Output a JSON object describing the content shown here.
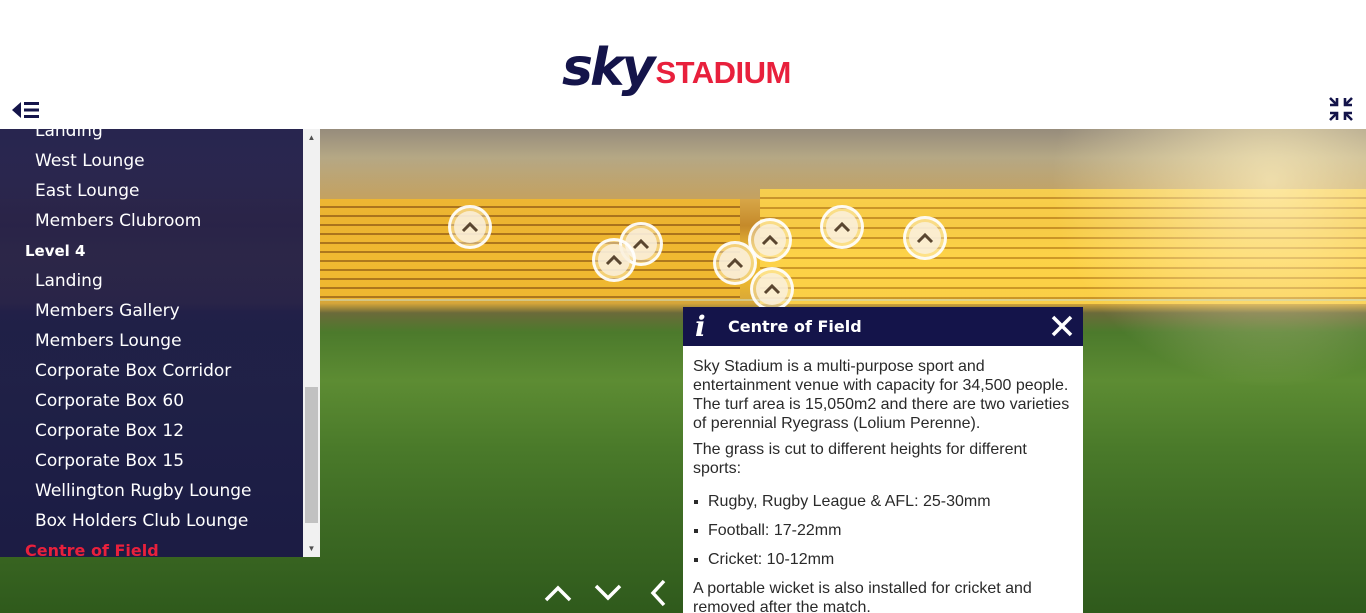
{
  "brand": {
    "logo_primary": "sky",
    "logo_secondary": "STADIUM",
    "primary_color": "#14144a",
    "accent_color": "#e8203c"
  },
  "header": {
    "menu_icon": "menu-collapse-icon",
    "fullscreen_icon": "exit-fullscreen-icon"
  },
  "sidebar": {
    "items": [
      {
        "label": "Landing",
        "type": "item"
      },
      {
        "label": "West Lounge",
        "type": "item"
      },
      {
        "label": "East Lounge",
        "type": "item"
      },
      {
        "label": "Members Clubroom",
        "type": "item"
      },
      {
        "label": "Level 4",
        "type": "level"
      },
      {
        "label": "Landing",
        "type": "item"
      },
      {
        "label": "Members Gallery",
        "type": "item"
      },
      {
        "label": "Members Lounge",
        "type": "item"
      },
      {
        "label": "Corporate Box Corridor",
        "type": "item"
      },
      {
        "label": "Corporate Box 60",
        "type": "item"
      },
      {
        "label": "Corporate Box 12",
        "type": "item"
      },
      {
        "label": "Corporate Box 15",
        "type": "item"
      },
      {
        "label": "Wellington Rugby Lounge",
        "type": "item"
      },
      {
        "label": "Box Holders Club Lounge",
        "type": "item"
      },
      {
        "label": "Centre of Field",
        "type": "active"
      }
    ]
  },
  "info_panel": {
    "title": "Centre of Field",
    "icon": "info-icon",
    "paragraph1": "Sky Stadium is a multi-purpose sport and entertainment venue with capacity for 34,500 people. The turf area is 15,050m2 and there are two varieties of perennial Ryegrass (Lolium Perenne).",
    "paragraph2": "The grass is cut to different heights for different sports:",
    "bullets": [
      "Rugby, Rugby League & AFL: 25-30mm",
      "Football: 17-22mm",
      "Cricket: 10-12mm"
    ],
    "paragraph3": "A portable wicket is also installed for cricket and removed after the match."
  },
  "hotspots": {
    "count": 8,
    "icon": "chevron-up-icon"
  },
  "controls": {
    "up_icon": "arrow-up-icon",
    "down_icon": "arrow-down-icon",
    "left_icon": "arrow-left-icon"
  }
}
